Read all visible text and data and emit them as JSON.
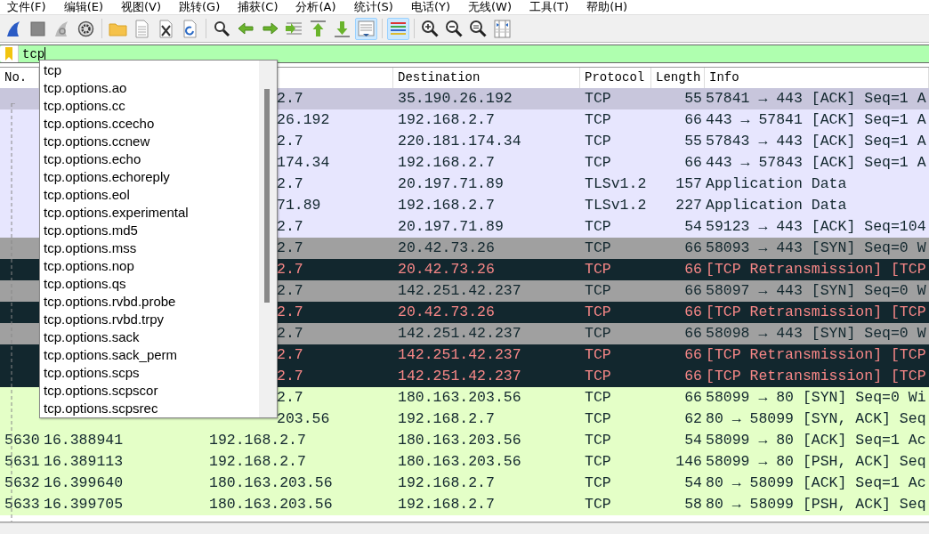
{
  "menu": [
    {
      "label": "文件(F)"
    },
    {
      "label": "编辑(E)"
    },
    {
      "label": "视图(V)"
    },
    {
      "label": "跳转(G)"
    },
    {
      "label": "捕获(C)"
    },
    {
      "label": "分析(A)"
    },
    {
      "label": "统计(S)"
    },
    {
      "label": "电话(Y)"
    },
    {
      "label": "无线(W)"
    },
    {
      "label": "工具(T)"
    },
    {
      "label": "帮助(H)"
    }
  ],
  "toolbar": [
    [
      {
        "kind": "start",
        "on": false
      },
      {
        "kind": "stop",
        "on": false
      },
      {
        "kind": "restart",
        "on": false
      },
      {
        "kind": "options",
        "on": false
      }
    ],
    [
      {
        "kind": "open",
        "on": false
      },
      {
        "kind": "file",
        "on": false
      },
      {
        "kind": "close",
        "on": false
      },
      {
        "kind": "reload",
        "on": false
      }
    ],
    [
      {
        "kind": "find",
        "on": false
      },
      {
        "kind": "back",
        "on": false
      },
      {
        "kind": "forward",
        "on": false
      },
      {
        "kind": "goto",
        "on": false
      },
      {
        "kind": "first",
        "on": false
      },
      {
        "kind": "last",
        "on": false
      },
      {
        "kind": "autoscroll",
        "on": true
      }
    ],
    [
      {
        "kind": "colorize",
        "on": true
      }
    ],
    [
      {
        "kind": "zoomin",
        "on": false
      },
      {
        "kind": "zoomout",
        "on": false
      },
      {
        "kind": "zoomreset",
        "on": false
      },
      {
        "kind": "resize",
        "on": false
      }
    ]
  ],
  "filter": {
    "value": "tcp"
  },
  "suggestions": [
    "tcp",
    "tcp.options.ao",
    "tcp.options.cc",
    "tcp.options.ccecho",
    "tcp.options.ccnew",
    "tcp.options.echo",
    "tcp.options.echoreply",
    "tcp.options.eol",
    "tcp.options.experimental",
    "tcp.options.md5",
    "tcp.options.mss",
    "tcp.options.nop",
    "tcp.options.qs",
    "tcp.options.rvbd.probe",
    "tcp.options.rvbd.trpy",
    "tcp.options.sack",
    "tcp.options.sack_perm",
    "tcp.options.scps",
    "tcp.options.scpscor",
    "tcp.options.scpsrec"
  ],
  "columns": {
    "no": "No.",
    "destination": "Destination",
    "protocol": "Protocol",
    "length": "Length",
    "info": "Info"
  },
  "rows": [
    {
      "kind": "normal",
      "color": "#c8c6dc",
      "source": "2.7",
      "destination": "35.190.26.192",
      "protocol": "TCP",
      "length": "55",
      "info": "57841 → 443 [ACK] Seq=1 A"
    },
    {
      "kind": "normal",
      "color": "#e7e6fe",
      "source": "26.192",
      "destination": "192.168.2.7",
      "protocol": "TCP",
      "length": "66",
      "info": "443 → 57841 [ACK] Seq=1 A"
    },
    {
      "kind": "normal",
      "color": "#e7e6fe",
      "source": "2.7",
      "destination": "220.181.174.34",
      "protocol": "TCP",
      "length": "55",
      "info": "57843 → 443 [ACK] Seq=1 A"
    },
    {
      "kind": "normal",
      "color": "#e7e6fe",
      "source": "174.34",
      "destination": "192.168.2.7",
      "protocol": "TCP",
      "length": "66",
      "info": "443 → 57843 [ACK] Seq=1 A"
    },
    {
      "kind": "normal",
      "color": "#e7e6fe",
      "source": "2.7",
      "destination": "20.197.71.89",
      "protocol": "TLSv1.2",
      "length": "157",
      "info": "Application Data"
    },
    {
      "kind": "normal",
      "color": "#e7e6fe",
      "source": "71.89",
      "destination": "192.168.2.7",
      "protocol": "TLSv1.2",
      "length": "227",
      "info": "Application Data"
    },
    {
      "kind": "normal",
      "color": "#e7e6fe",
      "source": "2.7",
      "destination": "20.197.71.89",
      "protocol": "TCP",
      "length": "54",
      "info": "59123 → 443 [ACK] Seq=104"
    },
    {
      "kind": "normal",
      "color": "#a0a0a0",
      "source": "2.7",
      "destination": "20.42.73.26",
      "protocol": "TCP",
      "length": "66",
      "info": "58093 → 443 [SYN] Seq=0 W"
    },
    {
      "kind": "error",
      "color": "#12272e",
      "source": "2.7",
      "destination": "20.42.73.26",
      "protocol": "TCP",
      "length": "66",
      "info": "[TCP Retransmission] [TCP"
    },
    {
      "kind": "normal",
      "color": "#a0a0a0",
      "source": "2.7",
      "destination": "142.251.42.237",
      "protocol": "TCP",
      "length": "66",
      "info": "58097 → 443 [SYN] Seq=0 W"
    },
    {
      "kind": "error",
      "color": "#12272e",
      "source": "2.7",
      "destination": "20.42.73.26",
      "protocol": "TCP",
      "length": "66",
      "info": "[TCP Retransmission] [TCP"
    },
    {
      "kind": "normal",
      "color": "#a0a0a0",
      "source": "2.7",
      "destination": "142.251.42.237",
      "protocol": "TCP",
      "length": "66",
      "info": "58098 → 443 [SYN] Seq=0 W"
    },
    {
      "kind": "error",
      "color": "#12272e",
      "source": "2.7",
      "destination": "142.251.42.237",
      "protocol": "TCP",
      "length": "66",
      "info": "[TCP Retransmission] [TCP"
    },
    {
      "kind": "error",
      "color": "#12272e",
      "source": "2.7",
      "destination": "142.251.42.237",
      "protocol": "TCP",
      "length": "66",
      "info": "[TCP Retransmission] [TCP"
    },
    {
      "kind": "normal",
      "color": "#e4ffc7",
      "source": "2.7",
      "destination": "180.163.203.56",
      "protocol": "TCP",
      "length": "66",
      "info": "58099 → 80 [SYN] Seq=0 Wi"
    },
    {
      "kind": "normal",
      "color": "#e4ffc7",
      "source": "203.56",
      "destination": "192.168.2.7",
      "protocol": "TCP",
      "length": "62",
      "info": "80 → 58099 [SYN, ACK] Seq"
    },
    {
      "kind": "normal",
      "color": "#e4ffc7",
      "no": "5630",
      "time": "16.388941",
      "source": "192.168.2.7",
      "destination": "180.163.203.56",
      "protocol": "TCP",
      "length": "54",
      "info": "58099 → 80 [ACK] Seq=1 Ac"
    },
    {
      "kind": "normal",
      "color": "#e4ffc7",
      "no": "5631",
      "time": "16.389113",
      "source": "192.168.2.7",
      "destination": "180.163.203.56",
      "protocol": "TCP",
      "length": "146",
      "info": "58099 → 80 [PSH, ACK] Seq"
    },
    {
      "kind": "normal",
      "color": "#e4ffc7",
      "no": "5632",
      "time": "16.399640",
      "source": "180.163.203.56",
      "destination": "192.168.2.7",
      "protocol": "TCP",
      "length": "54",
      "info": "80 → 58099 [ACK] Seq=1 Ac"
    },
    {
      "kind": "normal",
      "color": "#e4ffc7",
      "no": "5633",
      "time": "16.399705",
      "source": "180.163.203.56",
      "destination": "192.168.2.7",
      "protocol": "TCP",
      "length": "58",
      "info": "80 → 58099 [PSH, ACK] Seq"
    }
  ]
}
